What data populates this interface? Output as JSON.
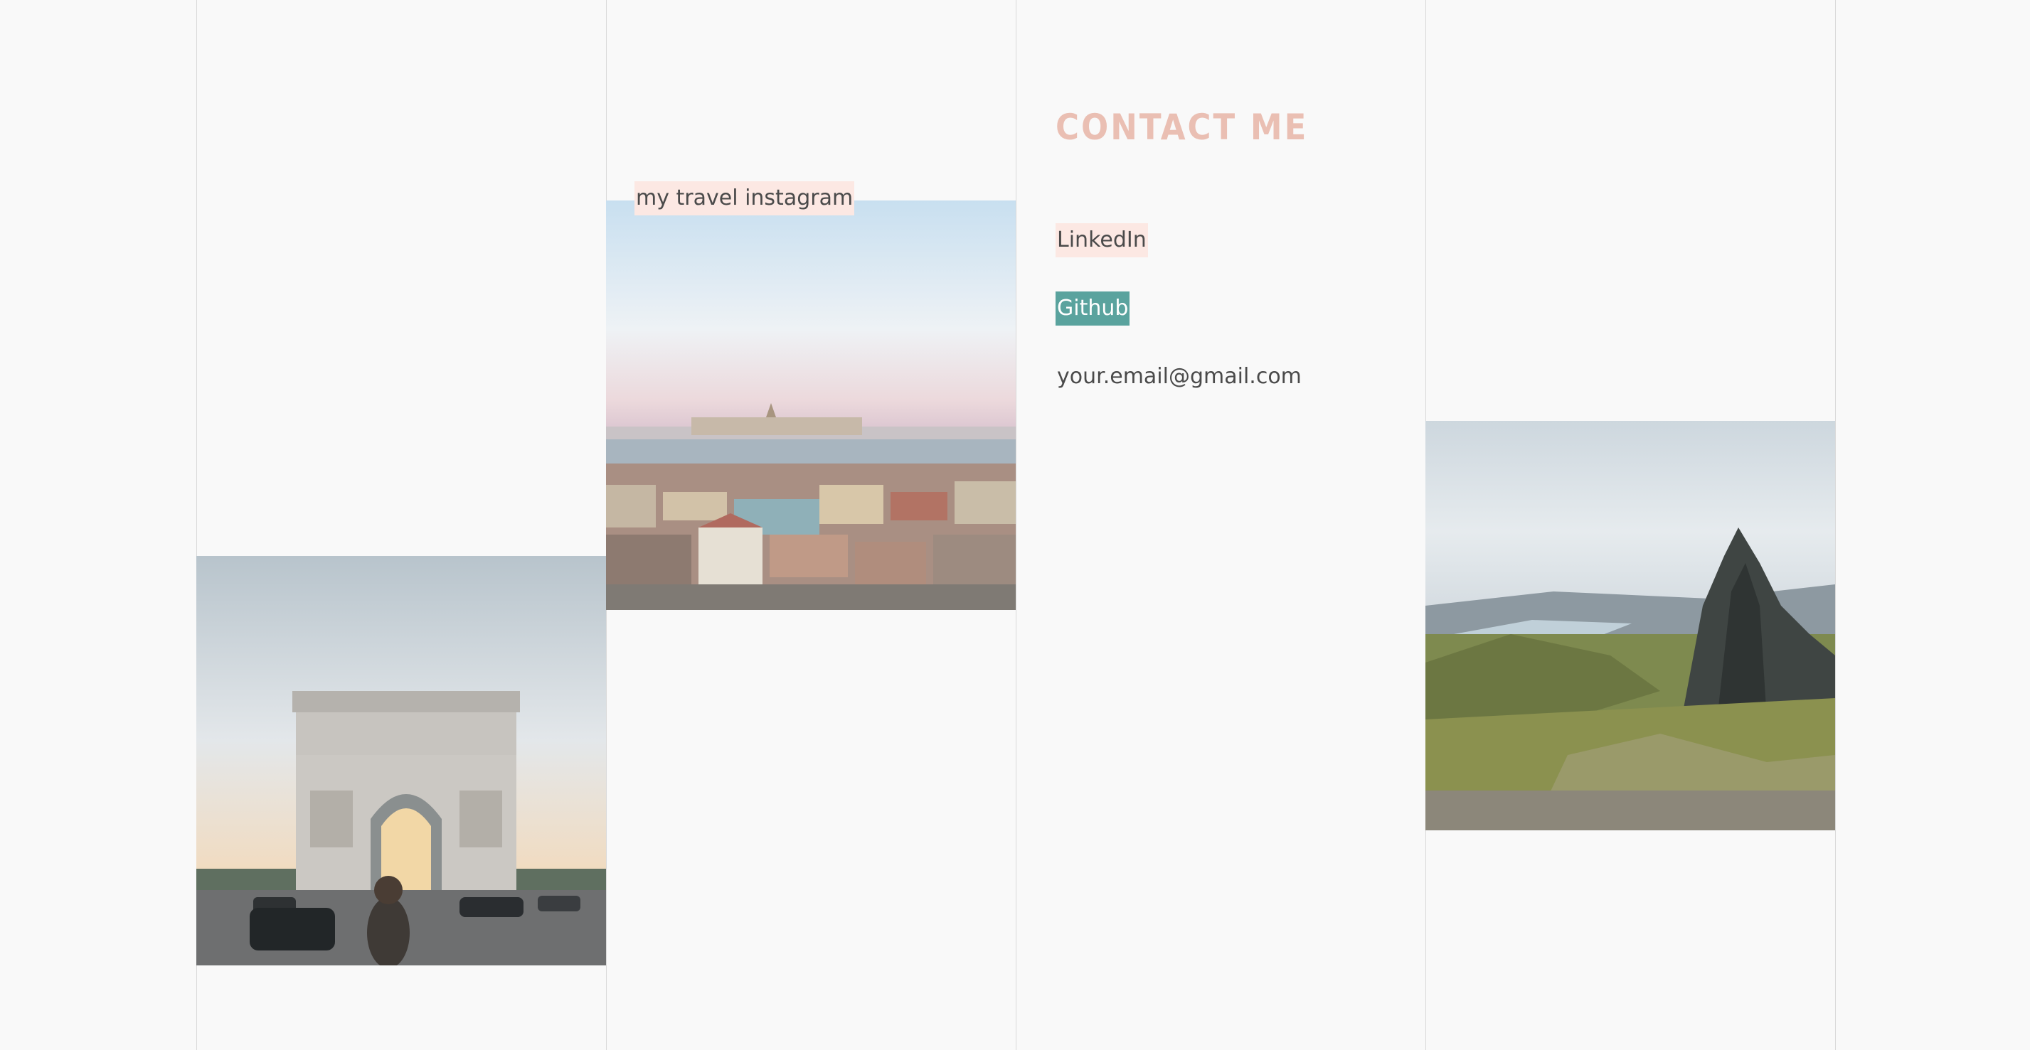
{
  "travel": {
    "instagram_label": "my travel instagram"
  },
  "contact": {
    "heading": "CONTACT ME",
    "linkedin_label": "LinkedIn",
    "github_label": "Github",
    "email": "your.email@gmail.com"
  },
  "colors": {
    "background": "#f9f9f9",
    "heading_accent": "#eabfb3",
    "link_highlight": "#fce8e3",
    "github_highlight": "#5aa39e",
    "text": "#4a4a4a",
    "grid_line": "#d9d9d9"
  }
}
